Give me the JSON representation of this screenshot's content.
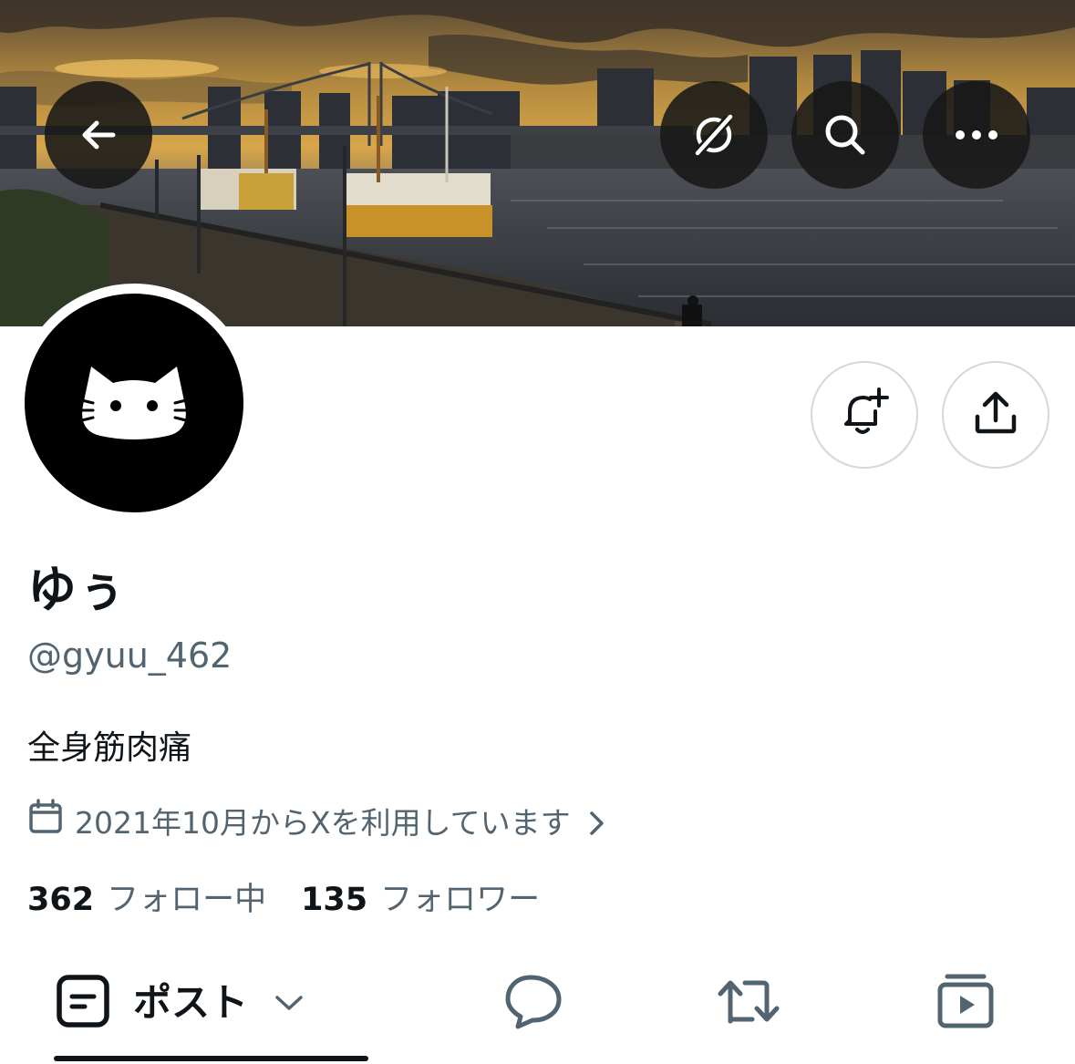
{
  "header": {
    "back_icon": "arrow-left-icon",
    "grok_icon": "grok-icon",
    "search_icon": "search-icon",
    "more_icon": "more-horizontal-icon",
    "banner": "sunset-harbor-cityscape-photo"
  },
  "actions": {
    "notify_icon": "bell-plus-icon",
    "share_icon": "share-upload-icon"
  },
  "profile": {
    "avatar": "cat-face-avatar",
    "display_name": "ゆぅ",
    "handle": "@gyuu_462",
    "bio": "全身筋肉痛",
    "joined_text": "2021年10月からXを利用しています",
    "joined_icon": "calendar-icon",
    "following_count": "362",
    "following_label": "フォロー中",
    "followers_count": "135",
    "followers_label": "フォロワー"
  },
  "tabs": {
    "posts_label": "ポスト",
    "posts_icon": "post-icon",
    "replies_icon": "reply-bubble-icon",
    "reposts_icon": "repost-icon",
    "media_icon": "media-video-icon",
    "active": "posts"
  },
  "colors": {
    "text_primary": "#0f1419",
    "text_secondary": "#536471",
    "border": "#cfd9de",
    "overlay_button": "#181818"
  }
}
